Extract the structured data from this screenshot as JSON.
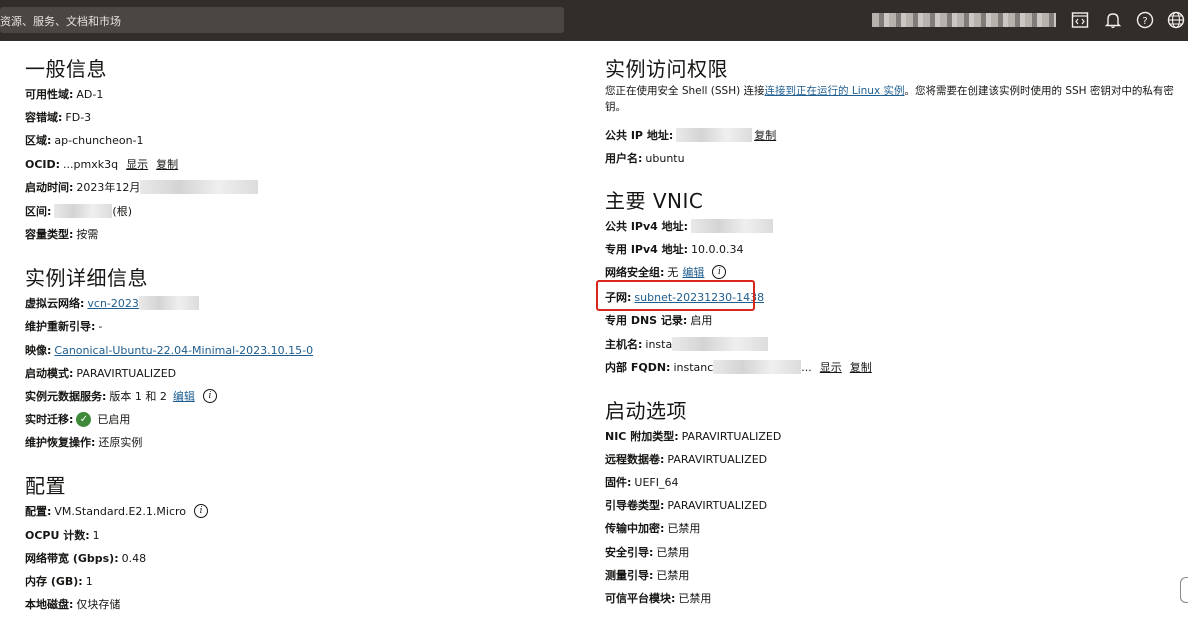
{
  "header": {
    "search_placeholder": "资源、服务、文档和市场",
    "icons": [
      "cloud-shell-icon",
      "bell-icon",
      "help-icon",
      "globe-icon"
    ]
  },
  "general": {
    "title": "一般信息",
    "availability_domain": {
      "label": "可用性域:",
      "value": "AD-1"
    },
    "fault_domain": {
      "label": "容错域:",
      "value": "FD-3"
    },
    "region": {
      "label": "区域:",
      "value": "ap-chuncheon-1"
    },
    "ocid": {
      "label": "OCID:",
      "value": "...pmxk3q",
      "show": "显示",
      "copy": "复制"
    },
    "launched": {
      "label": "启动时间:",
      "value": "2023年12月"
    },
    "compartment": {
      "label": "区间:",
      "suffix": "(根)"
    },
    "capacity_type": {
      "label": "容量类型:",
      "value": "按需"
    }
  },
  "details": {
    "title": "实例详细信息",
    "vcn": {
      "label": "虚拟云网络:",
      "value": "vcn-2023"
    },
    "maintenance_reboot": {
      "label": "维护重新引导:",
      "value": "-"
    },
    "image": {
      "label": "映像:",
      "value": "Canonical-Ubuntu-22.04-Minimal-2023.10.15-0"
    },
    "launch_mode": {
      "label": "启动模式:",
      "value": "PARAVIRTUALIZED"
    },
    "metadata_service": {
      "label": "实例元数据服务:",
      "value": "版本 1 和 2",
      "edit": "编辑"
    },
    "live_migration": {
      "label": "实时迁移:",
      "value": "已启用"
    },
    "recovery_action": {
      "label": "维护恢复操作:",
      "value": "还原实例"
    }
  },
  "config": {
    "title": "配置",
    "shape": {
      "label": "配置:",
      "value": "VM.Standard.E2.1.Micro"
    },
    "ocpu": {
      "label": "OCPU 计数:",
      "value": "1"
    },
    "bandwidth": {
      "label": "网络带宽 (Gbps):",
      "value": "0.48"
    },
    "memory": {
      "label": "内存 (GB):",
      "value": "1"
    },
    "local_disk": {
      "label": "本地磁盘:",
      "value": "仅块存储"
    }
  },
  "access": {
    "title": "实例访问权限",
    "desc_before": "您正在使用安全 Shell (SSH) 连接",
    "desc_link": "连接到正在运行的 Linux 实例",
    "desc_after": "。您将需要在创建该实例时使用的 SSH 密钥对中的私有密钥。",
    "public_ip": {
      "label": "公共 IP 地址:",
      "copy": "复制"
    },
    "username": {
      "label": "用户名:",
      "value": "ubuntu"
    }
  },
  "vnic": {
    "title": "主要 VNIC",
    "public_ipv4": {
      "label": "公共 IPv4 地址:"
    },
    "private_ipv4": {
      "label": "专用 IPv4 地址:",
      "value": "10.0.0.34"
    },
    "nsg": {
      "label": "网络安全组:",
      "value": "无",
      "edit": "编辑"
    },
    "subnet": {
      "label": "子网:",
      "value": "subnet-20231230-1438"
    },
    "private_dns": {
      "label": "专用 DNS 记录:",
      "value": "启用"
    },
    "hostname": {
      "label": "主机名:",
      "value": "insta"
    },
    "fqdn": {
      "label": "内部 FQDN:",
      "value": "instanc",
      "ellipsis": "...",
      "show": "显示",
      "copy": "复制"
    }
  },
  "launch_options": {
    "title": "启动选项",
    "nic_attachment": {
      "label": "NIC 附加类型:",
      "value": "PARAVIRTUALIZED"
    },
    "remote_volume": {
      "label": "远程数据卷:",
      "value": "PARAVIRTUALIZED"
    },
    "firmware": {
      "label": "固件:",
      "value": "UEFI_64"
    },
    "boot_volume_type": {
      "label": "引导卷类型:",
      "value": "PARAVIRTUALIZED"
    },
    "in_transit_encryption": {
      "label": "传输中加密:",
      "value": "已禁用"
    },
    "secure_boot": {
      "label": "安全引导:",
      "value": "已禁用"
    },
    "measured_boot": {
      "label": "测量引导:",
      "value": "已禁用"
    },
    "trusted_platform": {
      "label": "可信平台模块:",
      "value": "已禁用"
    }
  }
}
